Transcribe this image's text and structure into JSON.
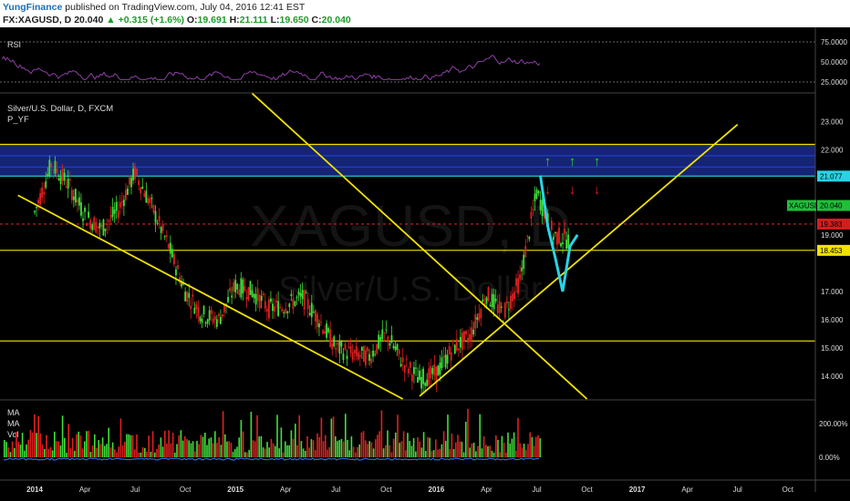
{
  "header": {
    "author": "YungFinance",
    "published": "published on TradingView.com, July 04, 2016 12:41 EST",
    "symbol": "FX:XAGUSD, D",
    "last": "20.040",
    "change": "+0.315 (+1.6%)",
    "o_label": "O:",
    "o_value": "19.691",
    "h_label": "H:",
    "h_value": "21.111",
    "l_label": "L:",
    "l_value": "19.650",
    "c_label": "C:",
    "c_value": "20.040"
  },
  "rsi_panel": {
    "label": "RSI",
    "yticks": [
      "75.0000",
      "50.0000",
      "25.0000"
    ],
    "line_color": "#8e3fa6"
  },
  "main_panel": {
    "title": "Silver/U.S. Dollar, D, FXCM",
    "indicator": "P_YF",
    "watermark_symbol": "XAGUSD, D",
    "watermark_desc": "Silver/U.S. Dollar",
    "yticks": [
      "23.000",
      "22.000",
      "21.000",
      "19.000",
      "17.000",
      "16.000",
      "15.000",
      "14.000"
    ],
    "price_labels": [
      {
        "text": "21.077",
        "color": "#29d3e6",
        "value": 21.077
      },
      {
        "text": "XAGUSD",
        "color": "#1fbf3a",
        "value": 20.04,
        "kind": "name"
      },
      {
        "text": "20.040",
        "color": "#1fbf3a",
        "value": 20.04
      },
      {
        "text": "19.383",
        "color": "#d11f1f",
        "value": 19.383
      },
      {
        "text": "18.453",
        "color": "#f2e200",
        "value": 18.453
      }
    ]
  },
  "volume_panel": {
    "labels": [
      "MA",
      "MA",
      "Vol"
    ],
    "yticks": [
      "200.00%",
      "0.00%"
    ]
  },
  "x_axis": [
    "2014",
    "Apr",
    "Jul",
    "Oct",
    "2015",
    "Apr",
    "Jul",
    "Oct",
    "2016",
    "Apr",
    "Jul",
    "Oct",
    "2017",
    "Apr",
    "Jul",
    "Oct"
  ],
  "chart_data": {
    "type": "line",
    "title": "Silver/U.S. Dollar, D, FXCM",
    "xlabel": "",
    "ylabel": "",
    "ylim": [
      13.2,
      23.6
    ],
    "x": [
      "2014-01",
      "2014-02",
      "2014-03",
      "2014-04",
      "2014-05",
      "2014-06",
      "2014-07",
      "2014-08",
      "2014-09",
      "2014-10",
      "2014-11",
      "2014-12",
      "2015-01",
      "2015-02",
      "2015-03",
      "2015-04",
      "2015-05",
      "2015-06",
      "2015-07",
      "2015-08",
      "2015-09",
      "2015-10",
      "2015-11",
      "2015-12",
      "2016-01",
      "2016-02",
      "2016-03",
      "2016-04",
      "2016-05",
      "2016-06",
      "2016-07",
      "2016-08",
      "2016-09"
    ],
    "series": [
      {
        "values": [
          19.8,
          21.5,
          20.8,
          19.7,
          19.2,
          19.9,
          21.2,
          20.0,
          18.6,
          17.0,
          16.2,
          16.0,
          17.2,
          17.0,
          16.4,
          16.5,
          16.8,
          16.0,
          15.0,
          14.8,
          14.7,
          15.5,
          14.5,
          13.9,
          14.1,
          15.0,
          15.4,
          16.9,
          16.2,
          17.4,
          20.5,
          19.0,
          18.8
        ]
      }
    ],
    "horizontal_levels": [
      {
        "value": 22.2,
        "color": "#f2e200"
      },
      {
        "value": 21.8,
        "color": "#1f3fd6"
      },
      {
        "value": 21.4,
        "color": "#1f3fd6"
      },
      {
        "value": 21.077,
        "color": "#29d3e6"
      },
      {
        "value": 19.383,
        "color": "#d11f1f"
      },
      {
        "value": 18.453,
        "color": "#f2e200"
      },
      {
        "value": 15.25,
        "color": "#f2e200"
      }
    ],
    "trend_lines": [
      {
        "from": [
          "2013-12",
          20.4
        ],
        "to": [
          "2015-11",
          13.2
        ]
      },
      {
        "from": [
          "2015-02",
          24.0
        ],
        "to": [
          "2016-10",
          13.2
        ]
      },
      {
        "from": [
          "2015-12",
          13.3
        ],
        "to": [
          "2017-07",
          22.9
        ]
      }
    ],
    "arrows_up": [
      "2016-07",
      "2016-08",
      "2016-09"
    ],
    "arrows_down": [
      "2016-07",
      "2016-08",
      "2016-09"
    ],
    "projection": [
      21.1,
      19.3,
      18.2,
      17.0,
      18.6,
      19.0
    ]
  },
  "colors": {
    "background": "#000000",
    "trend": "#f2e200",
    "up_candle": "#3fe03a",
    "down_candle": "#e02020",
    "projection": "#29d3e6",
    "zone": "#1a2a8a"
  }
}
